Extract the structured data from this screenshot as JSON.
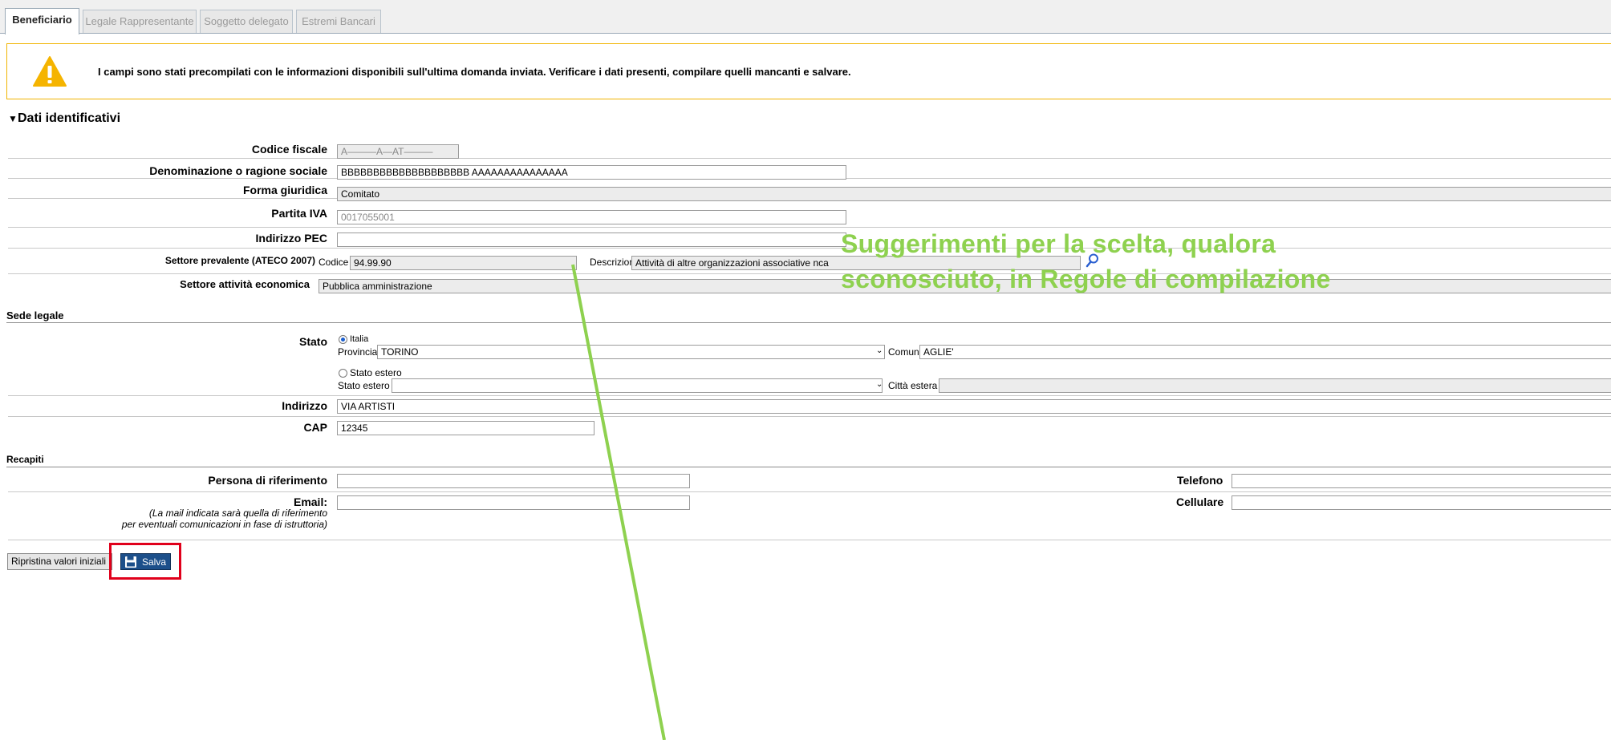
{
  "tabs": [
    "Beneficiario",
    "Legale Rappresentante",
    "Soggetto delegato",
    "Estremi Bancari"
  ],
  "alert": {
    "icon": "warning-icon",
    "text": "I campi sono stati precompilati con le informazioni disponibili sull'ultima domanda inviata. Verificare i dati presenti, compilare quelli mancanti e salvare."
  },
  "dati": {
    "title": "Dati identificativi",
    "codice_fiscale_label": "Codice fiscale",
    "codice_fiscale_value": "A———A—AT———",
    "denominazione_label": "Denominazione o ragione sociale",
    "denominazione_value": "BBBBBBBBBBBBBBBBBBBB AAAAAAAAAAAAAAA",
    "forma_label": "Forma giuridica",
    "forma_value": "Comitato",
    "piva_label": "Partita IVA",
    "piva_value": "0017055001",
    "pec_label": "Indirizzo PEC",
    "pec_value": "",
    "settore_label": "Settore prevalente (ATECO 2007)",
    "codice_label": "Codice",
    "codice_value": "94.99.90",
    "descrizione_label": "Descrizione",
    "descrizione_value": "Attività di altre organizzazioni associative nca",
    "attivita_label": "Settore attività economica",
    "attivita_value": "Pubblica amministrazione"
  },
  "sede": {
    "title": "Sede legale",
    "stato_label": "Stato",
    "italia_label": "Italia",
    "provincia_label": "Provincia",
    "provincia_value": "TORINO",
    "comune_label": "Comune",
    "comune_value": "AGLIE'",
    "estero_radio_label": "Stato estero",
    "estero_label": "Stato estero",
    "estero_value": "",
    "citta_label": "Città estera",
    "citta_value": "",
    "indirizzo_label": "Indirizzo",
    "indirizzo_value": "VIA ARTISTI",
    "cap_label": "CAP",
    "cap_value": "12345"
  },
  "recapiti": {
    "title": "Recapiti",
    "persona_label": "Persona di riferimento",
    "persona_value": "",
    "email_label": "Email:",
    "email_note_1": "(La mail indicata sarà quella di riferimento",
    "email_note_2": "per eventuali comunicazioni in fase di istruttoria)",
    "email_value": "",
    "telefono_label": "Telefono",
    "cellulare_label": "Cellulare"
  },
  "buttons": {
    "ripristina": "Ripristina valori iniziali",
    "salva": "Salva"
  },
  "annotation": {
    "line1": "Suggerimenti per la scelta, qualora",
    "line2": "sconosciuto, in Regole di compilazione",
    "color": "#8ed14f",
    "highlight_color": "#e0001b"
  }
}
